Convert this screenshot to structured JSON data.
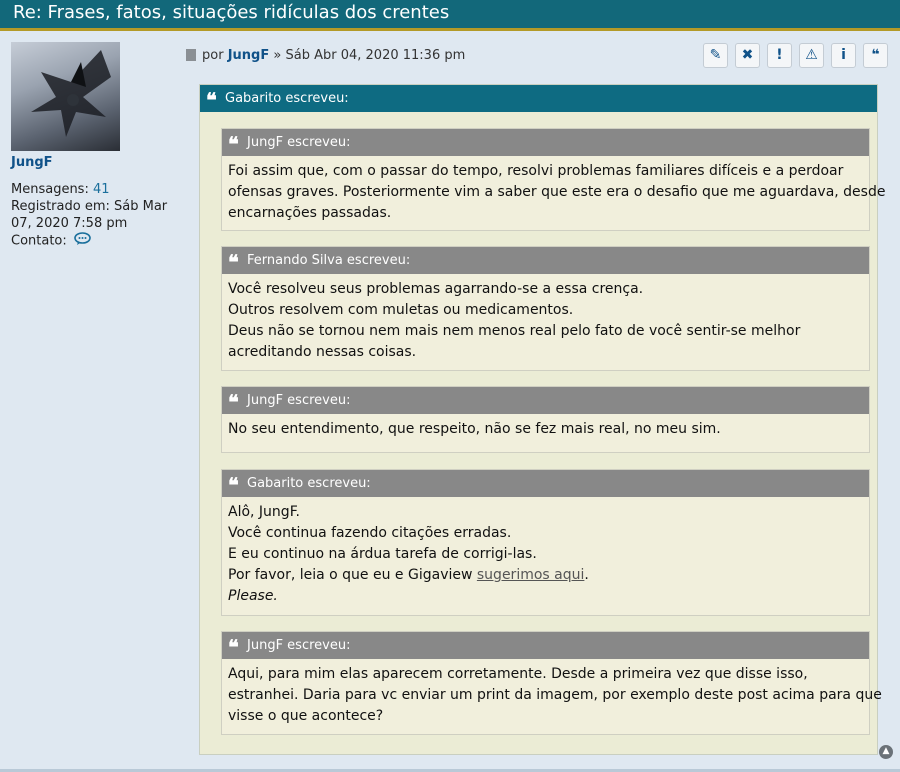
{
  "topic": {
    "title": "Re: Frases, fatos, situações ridículas dos crentes"
  },
  "profile": {
    "username": "JungF",
    "posts_label": "Mensagens:",
    "posts_count": "41",
    "registered_label": "Registrado em:",
    "registered_date": "Sáb Mar 07, 2020 7:58 pm",
    "contact_label": "Contato:"
  },
  "post": {
    "by_label": "por",
    "author": "JungF",
    "separator": "»",
    "date": "Sáb Abr 04, 2020 11:36 pm",
    "actions": [
      {
        "icon": "edit-icon",
        "glyph": "✎"
      },
      {
        "icon": "delete-icon",
        "glyph": "✖"
      },
      {
        "icon": "warn-icon",
        "glyph": "!"
      },
      {
        "icon": "report-icon",
        "glyph": "⚠"
      },
      {
        "icon": "info-icon",
        "glyph": "i"
      },
      {
        "icon": "quote-icon",
        "glyph": "❝"
      }
    ]
  },
  "outer_quote": {
    "header": "Gabarito escreveu:"
  },
  "quotes": [
    {
      "header": "JungF escreveu:",
      "lines": [
        "Foi assim que, com o passar do tempo, resolvi problemas familiares difíceis e a perdoar",
        "ofensas graves. Posteriormente vim a saber que este era o desafio que me aguardava, desde",
        "encarnações passadas."
      ]
    },
    {
      "header": "Fernando Silva escreveu:",
      "lines": [
        "Você resolveu seus problemas agarrando-se a essa crença.",
        "Outros resolvem com muletas ou medicamentos.",
        "Deus não se tornou nem mais nem menos real pelo fato de você sentir-se melhor",
        "acreditando nessas coisas."
      ]
    },
    {
      "header": "JungF escreveu:",
      "lines": [
        "No seu entendimento, que respeito, não se fez mais real, no meu sim."
      ]
    },
    {
      "header": "Gabarito escreveu:",
      "lines": [
        "Alô, JungF.",
        "Você continua fazendo citações erradas.",
        "E eu continuo na árdua tarefa de corrigi-las."
      ],
      "link_line_prefix": "Por favor, leia o que eu e Gigaview ",
      "link_text": "sugerimos aqui",
      "link_line_suffix": ".",
      "italic_line": "Please."
    },
    {
      "header": "JungF escreveu:",
      "lines": [
        "Aqui, para mim elas aparecem corretamente. Desde a primeira vez que disse isso,",
        "estranhei. Daria para vc enviar um print da imagem, por exemplo deste post acima para que",
        "visse o que acontece?"
      ]
    }
  ],
  "colors": {
    "header_bg": "#12687a",
    "header_border": "#b39a28",
    "quote_head": "#0e6b82",
    "inner_head": "#888888",
    "page_bg": "#dfe8f1"
  }
}
